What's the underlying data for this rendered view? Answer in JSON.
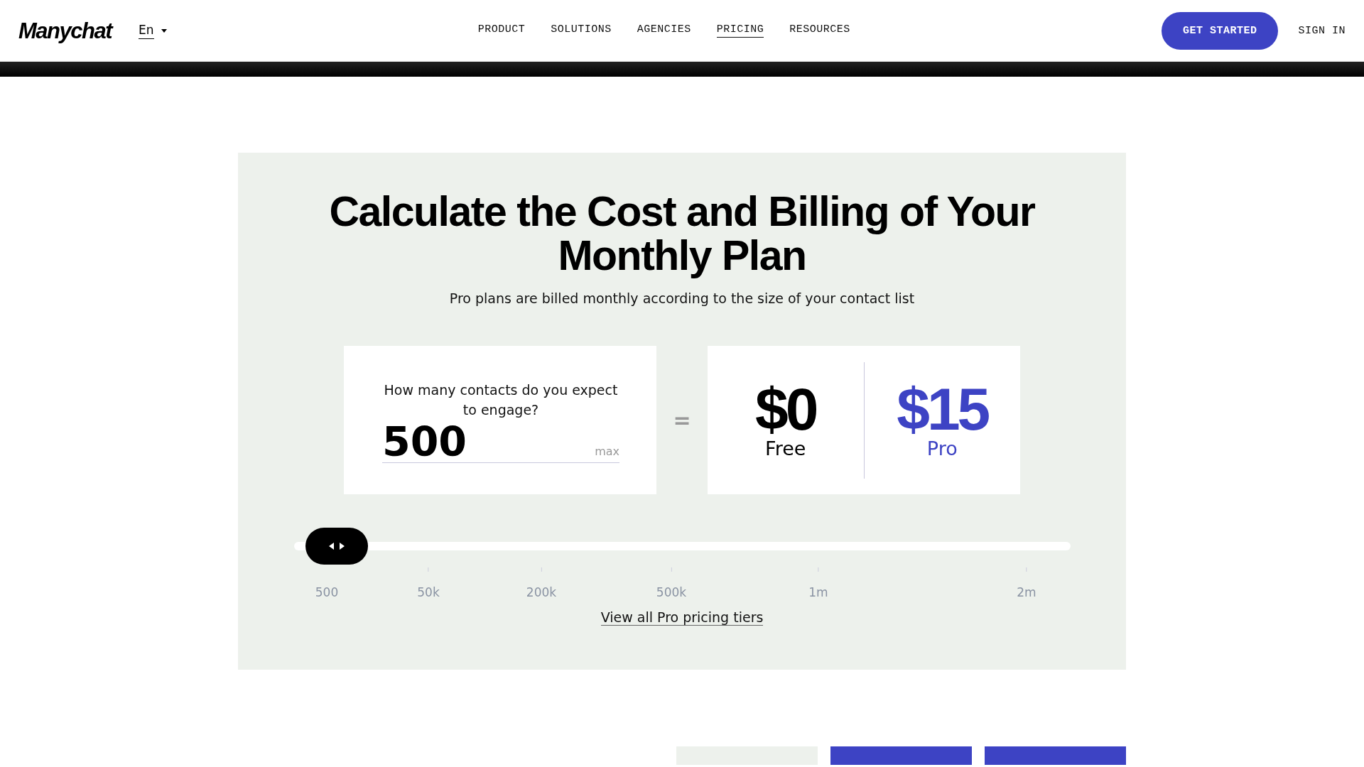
{
  "header": {
    "logo": "Manychat",
    "language": "En",
    "nav": [
      {
        "label": "PRODUCT",
        "selected": false
      },
      {
        "label": "SOLUTIONS",
        "selected": false
      },
      {
        "label": "AGENCIES",
        "selected": false
      },
      {
        "label": "PRICING",
        "selected": true
      },
      {
        "label": "RESOURCES",
        "selected": false
      }
    ],
    "cta": "GET STARTED",
    "sign_in": "SIGN IN"
  },
  "calculator": {
    "title": "Calculate the Cost and Billing of Your Monthly Plan",
    "subtitle": "Pro plans are billed monthly according to the size of your contact list",
    "question": "How many contacts do you expect to engage?",
    "contacts": "500",
    "max": "max",
    "equals": "=",
    "plans": [
      {
        "price": "$0",
        "name": "Free",
        "color": "#000000"
      },
      {
        "price": "$15",
        "name": "Pro",
        "color": "#3d43c4"
      }
    ],
    "slider": {
      "level": 0,
      "ticks": [
        "500",
        "50k",
        "200k",
        "500k",
        "1m",
        "2m"
      ]
    },
    "link": "View all Pro pricing tiers"
  },
  "compare": {
    "buttons": [
      {
        "kind": "light"
      },
      {
        "kind": "primary"
      },
      {
        "kind": "primary"
      }
    ]
  }
}
